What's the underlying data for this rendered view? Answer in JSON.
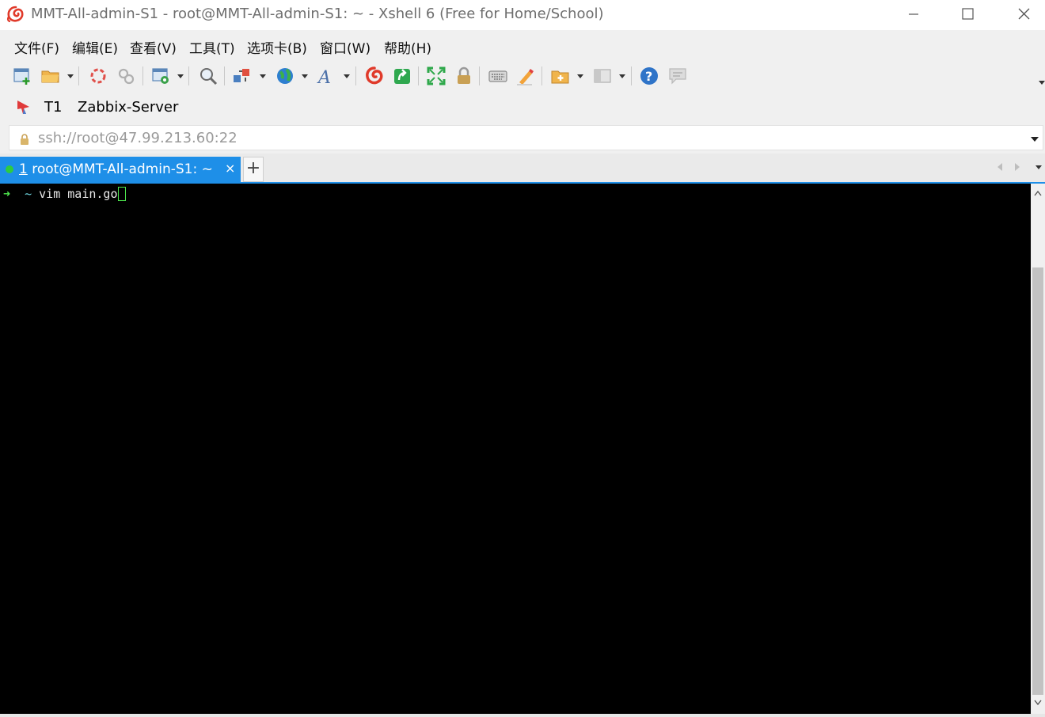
{
  "window": {
    "title": "MMT-All-admin-S1 - root@MMT-All-admin-S1: ~ - Xshell 6 (Free for Home/School)",
    "controls": [
      "minimize-icon",
      "maximize-icon",
      "close-icon"
    ]
  },
  "menu": {
    "file": "文件(F)",
    "edit": "编辑(E)",
    "view": "查看(V)",
    "tools": "工具(T)",
    "tabs": "选项卡(B)",
    "window": "窗口(W)",
    "help": "帮助(H)"
  },
  "toolbar": {
    "icons": [
      "new-session-icon",
      "open-folder-icon",
      "disconnect-icon",
      "reconnect-icon",
      "properties-icon",
      "find-icon",
      "transfer-icon",
      "globe-icon",
      "font-icon",
      "xshell-icon",
      "xftp-icon",
      "fullscreen-icon",
      "lock-icon",
      "keyboard-icon",
      "highlight-icon",
      "new-tab-icon",
      "layout-icon",
      "help-icon",
      "chat-icon"
    ]
  },
  "links": {
    "t1": "T1",
    "zabbix": "Zabbix-Server"
  },
  "address": {
    "value": "ssh://root@47.99.213.60:22"
  },
  "tabs": {
    "active_index": "1",
    "active_title": "root@MMT-All-admin-S1: ~",
    "close": "×",
    "add": "+"
  },
  "terminal": {
    "prompt_arrow": "➜",
    "cwd": "~",
    "command": "vim main.go"
  },
  "colors": {
    "tab_active": "#1e8fe8",
    "prompt_green": "#4ee84e",
    "terminal_bg": "#000000"
  }
}
